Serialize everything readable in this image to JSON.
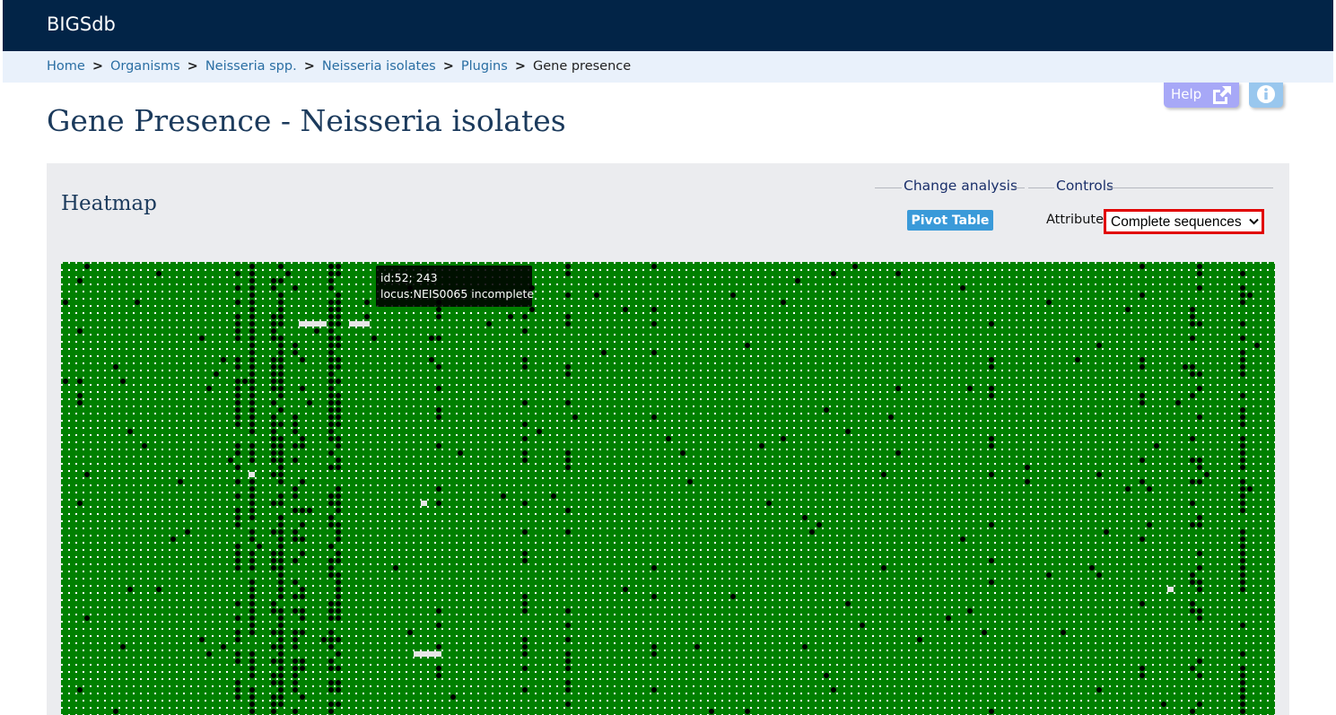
{
  "app": {
    "brand": "BIGSdb"
  },
  "breadcrumb": {
    "items": [
      {
        "label": "Home",
        "link": true
      },
      {
        "label": "Organisms",
        "link": true
      },
      {
        "label": "Neisseria spp.",
        "link": true
      },
      {
        "label": "Neisseria isolates",
        "link": true
      },
      {
        "label": "Plugins",
        "link": true
      },
      {
        "label": "Gene presence",
        "link": false
      }
    ],
    "separator": ">"
  },
  "toolbar": {
    "help_label": "Help",
    "help_icon": "external-link-icon",
    "info_icon": "info-icon"
  },
  "page": {
    "title": "Gene Presence - Neisseria isolates"
  },
  "heatmap": {
    "heading": "Heatmap",
    "change_analysis": {
      "legend": "Change analysis",
      "button_label": "Pivot Table"
    },
    "controls": {
      "legend": "Controls",
      "attribute_label": "Attribute:",
      "attribute_value": "Complete sequences"
    },
    "colors": {
      "present": "#008000",
      "absent": "#000000",
      "incomplete": "#e6e6e6",
      "separator": "#ffffff"
    },
    "tooltip": {
      "line1": "id:52; 243",
      "line2": "locus:NEIS0065 incomplete"
    }
  }
}
